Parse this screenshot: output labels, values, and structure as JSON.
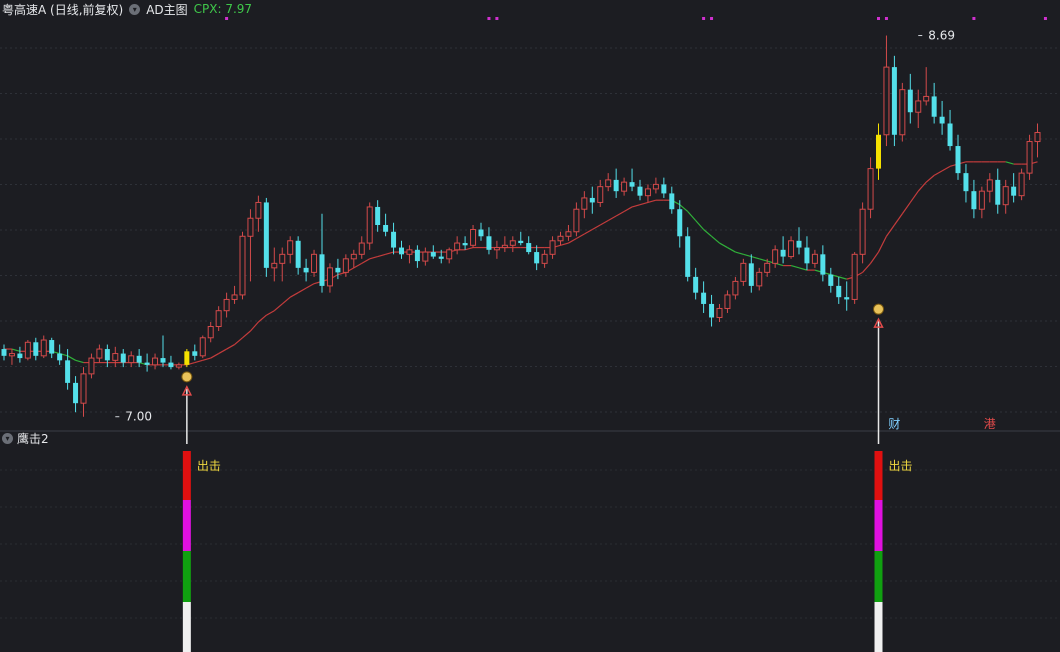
{
  "header": {
    "stock_title": "粤高速A (日线,前复权)",
    "indicator": "AD主图",
    "cpx_label": "CPX: 7.97"
  },
  "sub_panel": {
    "title": "鹰击2",
    "signal_label": "出击"
  },
  "chart_data": {
    "type": "candlestick",
    "series": [
      {
        "name": "",
        "kind": "ohlc",
        "ohlc": [
          [
            7.3,
            7.32,
            7.25,
            7.27
          ],
          [
            7.27,
            7.3,
            7.23,
            7.28
          ],
          [
            7.28,
            7.31,
            7.24,
            7.26
          ],
          [
            7.26,
            7.34,
            7.25,
            7.33
          ],
          [
            7.33,
            7.35,
            7.25,
            7.27
          ],
          [
            7.27,
            7.36,
            7.26,
            7.34
          ],
          [
            7.34,
            7.35,
            7.26,
            7.28
          ],
          [
            7.28,
            7.32,
            7.23,
            7.25
          ],
          [
            7.25,
            7.3,
            7.12,
            7.15
          ],
          [
            7.15,
            7.18,
            7.02,
            7.06
          ],
          [
            7.06,
            7.22,
            7.0,
            7.19
          ],
          [
            7.19,
            7.28,
            7.17,
            7.26
          ],
          [
            7.26,
            7.32,
            7.24,
            7.3
          ],
          [
            7.3,
            7.32,
            7.22,
            7.25
          ],
          [
            7.25,
            7.31,
            7.22,
            7.28
          ],
          [
            7.28,
            7.3,
            7.22,
            7.24
          ],
          [
            7.24,
            7.29,
            7.22,
            7.27
          ],
          [
            7.27,
            7.3,
            7.22,
            7.24
          ],
          [
            7.24,
            7.28,
            7.2,
            7.23
          ],
          [
            7.23,
            7.28,
            7.21,
            7.26
          ],
          [
            7.26,
            7.36,
            7.22,
            7.24
          ],
          [
            7.24,
            7.27,
            7.21,
            7.22
          ],
          [
            7.22,
            7.24,
            7.21,
            7.23
          ],
          [
            7.23,
            7.3,
            7.22,
            7.29
          ],
          [
            7.29,
            7.32,
            7.25,
            7.27
          ],
          [
            7.27,
            7.36,
            7.26,
            7.35
          ],
          [
            7.35,
            7.42,
            7.33,
            7.4
          ],
          [
            7.4,
            7.49,
            7.38,
            7.47
          ],
          [
            7.47,
            7.55,
            7.44,
            7.52
          ],
          [
            7.52,
            7.58,
            7.5,
            7.54
          ],
          [
            7.54,
            7.82,
            7.52,
            7.8
          ],
          [
            7.8,
            7.92,
            7.6,
            7.88
          ],
          [
            7.88,
            7.98,
            7.82,
            7.95
          ],
          [
            7.95,
            7.97,
            7.62,
            7.66
          ],
          [
            7.66,
            7.75,
            7.6,
            7.68
          ],
          [
            7.68,
            7.75,
            7.6,
            7.72
          ],
          [
            7.72,
            7.8,
            7.68,
            7.78
          ],
          [
            7.78,
            7.8,
            7.63,
            7.66
          ],
          [
            7.66,
            7.7,
            7.6,
            7.64
          ],
          [
            7.64,
            7.74,
            7.62,
            7.72
          ],
          [
            7.72,
            7.9,
            7.55,
            7.58
          ],
          [
            7.58,
            7.68,
            7.55,
            7.66
          ],
          [
            7.66,
            7.7,
            7.61,
            7.64
          ],
          [
            7.64,
            7.72,
            7.62,
            7.7
          ],
          [
            7.7,
            7.74,
            7.66,
            7.72
          ],
          [
            7.72,
            7.8,
            7.7,
            7.77
          ],
          [
            7.77,
            7.95,
            7.74,
            7.93
          ],
          [
            7.93,
            7.96,
            7.82,
            7.85
          ],
          [
            7.85,
            7.9,
            7.8,
            7.82
          ],
          [
            7.82,
            7.86,
            7.72,
            7.75
          ],
          [
            7.75,
            7.78,
            7.7,
            7.72
          ],
          [
            7.72,
            7.76,
            7.68,
            7.74
          ],
          [
            7.74,
            7.76,
            7.66,
            7.69
          ],
          [
            7.69,
            7.75,
            7.67,
            7.73
          ],
          [
            7.73,
            7.76,
            7.7,
            7.71
          ],
          [
            7.71,
            7.74,
            7.68,
            7.7
          ],
          [
            7.7,
            7.75,
            7.68,
            7.74
          ],
          [
            7.74,
            7.8,
            7.72,
            7.77
          ],
          [
            7.77,
            7.8,
            7.74,
            7.76
          ],
          [
            7.76,
            7.85,
            7.75,
            7.83
          ],
          [
            7.83,
            7.86,
            7.78,
            7.8
          ],
          [
            7.8,
            7.84,
            7.72,
            7.74
          ],
          [
            7.74,
            7.78,
            7.7,
            7.75
          ],
          [
            7.75,
            7.8,
            7.73,
            7.76
          ],
          [
            7.76,
            7.8,
            7.73,
            7.78
          ],
          [
            7.78,
            7.82,
            7.76,
            7.77
          ],
          [
            7.77,
            7.8,
            7.72,
            7.73
          ],
          [
            7.73,
            7.76,
            7.65,
            7.68
          ],
          [
            7.68,
            7.74,
            7.66,
            7.72
          ],
          [
            7.72,
            7.8,
            7.7,
            7.78
          ],
          [
            7.78,
            7.82,
            7.76,
            7.8
          ],
          [
            7.8,
            7.85,
            7.78,
            7.82
          ],
          [
            7.82,
            7.95,
            7.8,
            7.92
          ],
          [
            7.92,
            8.0,
            7.88,
            7.97
          ],
          [
            7.97,
            8.02,
            7.9,
            7.95
          ],
          [
            7.95,
            8.05,
            7.93,
            8.02
          ],
          [
            8.02,
            8.08,
            8.0,
            8.05
          ],
          [
            8.05,
            8.1,
            7.97,
            8.0
          ],
          [
            8.0,
            8.06,
            7.98,
            8.04
          ],
          [
            8.04,
            8.1,
            8.0,
            8.02
          ],
          [
            8.02,
            8.05,
            7.96,
            7.98
          ],
          [
            7.98,
            8.03,
            7.95,
            8.01
          ],
          [
            8.01,
            8.06,
            7.99,
            8.03
          ],
          [
            8.03,
            8.06,
            7.97,
            7.99
          ],
          [
            7.99,
            8.02,
            7.9,
            7.92
          ],
          [
            7.92,
            7.96,
            7.75,
            7.8
          ],
          [
            7.8,
            7.84,
            7.6,
            7.62
          ],
          [
            7.62,
            7.66,
            7.52,
            7.55
          ],
          [
            7.55,
            7.6,
            7.46,
            7.5
          ],
          [
            7.5,
            7.54,
            7.4,
            7.44
          ],
          [
            7.44,
            7.5,
            7.42,
            7.48
          ],
          [
            7.48,
            7.56,
            7.46,
            7.54
          ],
          [
            7.54,
            7.62,
            7.52,
            7.6
          ],
          [
            7.6,
            7.7,
            7.58,
            7.68
          ],
          [
            7.68,
            7.72,
            7.55,
            7.58
          ],
          [
            7.58,
            7.66,
            7.56,
            7.64
          ],
          [
            7.64,
            7.7,
            7.62,
            7.68
          ],
          [
            7.68,
            7.76,
            7.66,
            7.74
          ],
          [
            7.74,
            7.8,
            7.68,
            7.71
          ],
          [
            7.71,
            7.8,
            7.7,
            7.78
          ],
          [
            7.78,
            7.84,
            7.72,
            7.75
          ],
          [
            7.75,
            7.8,
            7.65,
            7.68
          ],
          [
            7.68,
            7.74,
            7.66,
            7.72
          ],
          [
            7.72,
            7.76,
            7.6,
            7.63
          ],
          [
            7.63,
            7.66,
            7.55,
            7.58
          ],
          [
            7.58,
            7.62,
            7.5,
            7.53
          ],
          [
            7.53,
            7.6,
            7.47,
            7.52
          ],
          [
            7.52,
            7.73,
            7.5,
            7.72
          ],
          [
            7.72,
            7.95,
            7.68,
            7.92
          ],
          [
            7.92,
            8.15,
            7.88,
            8.1
          ],
          [
            8.1,
            8.3,
            8.05,
            8.25
          ],
          [
            8.25,
            8.69,
            8.2,
            8.55
          ],
          [
            8.55,
            8.6,
            8.2,
            8.25
          ],
          [
            8.25,
            8.48,
            8.22,
            8.45
          ],
          [
            8.45,
            8.52,
            8.3,
            8.35
          ],
          [
            8.35,
            8.45,
            8.28,
            8.4
          ],
          [
            8.4,
            8.55,
            8.38,
            8.42
          ],
          [
            8.42,
            8.48,
            8.3,
            8.33
          ],
          [
            8.33,
            8.4,
            8.25,
            8.3
          ],
          [
            8.3,
            8.36,
            8.18,
            8.2
          ],
          [
            8.2,
            8.25,
            8.05,
            8.08
          ],
          [
            8.08,
            8.12,
            7.95,
            8.0
          ],
          [
            8.0,
            8.05,
            7.88,
            7.92
          ],
          [
            7.92,
            8.02,
            7.88,
            8.0
          ],
          [
            8.0,
            8.08,
            7.95,
            8.05
          ],
          [
            8.05,
            8.1,
            7.9,
            7.94
          ],
          [
            7.94,
            8.05,
            7.9,
            8.02
          ],
          [
            8.02,
            8.08,
            7.95,
            7.98
          ],
          [
            7.98,
            8.1,
            7.96,
            8.08
          ],
          [
            8.08,
            8.25,
            8.05,
            8.22
          ],
          [
            8.22,
            8.3,
            8.15,
            8.26
          ]
        ],
        "up_color": "#d34a4a",
        "down_color": "#54e0ea"
      },
      {
        "name": "",
        "kind": "line",
        "values": [
          7.3,
          7.3,
          7.29,
          7.29,
          7.29,
          7.29,
          7.29,
          7.28,
          7.27,
          7.25,
          7.24,
          7.24,
          7.24,
          7.24,
          7.24,
          7.24,
          7.24,
          7.24,
          7.23,
          7.23,
          7.23,
          7.23,
          7.23,
          7.23,
          7.24,
          7.25,
          7.26,
          7.28,
          7.3,
          7.32,
          7.35,
          7.38,
          7.42,
          7.45,
          7.47,
          7.5,
          7.53,
          7.55,
          7.57,
          7.59,
          7.6,
          7.61,
          7.63,
          7.64,
          7.66,
          7.68,
          7.7,
          7.71,
          7.72,
          7.73,
          7.73,
          7.73,
          7.73,
          7.73,
          7.73,
          7.73,
          7.73,
          7.74,
          7.74,
          7.75,
          7.75,
          7.75,
          7.75,
          7.75,
          7.75,
          7.75,
          7.75,
          7.75,
          7.75,
          7.75,
          7.76,
          7.77,
          7.79,
          7.81,
          7.83,
          7.85,
          7.87,
          7.89,
          7.91,
          7.93,
          7.94,
          7.95,
          7.96,
          7.96,
          7.96,
          7.94,
          7.91,
          7.87,
          7.83,
          7.8,
          7.77,
          7.75,
          7.73,
          7.72,
          7.71,
          7.7,
          7.69,
          7.68,
          7.67,
          7.67,
          7.66,
          7.65,
          7.65,
          7.64,
          7.63,
          7.62,
          7.61,
          7.62,
          7.64,
          7.68,
          7.73,
          7.8,
          7.85,
          7.9,
          7.95,
          8.0,
          8.04,
          8.07,
          8.09,
          8.11,
          8.12,
          8.13,
          8.13,
          8.13,
          8.13,
          8.13,
          8.13,
          8.12,
          8.12,
          8.12,
          8.13
        ],
        "up_color": "#c43c3c",
        "down_color": "#30b03a"
      }
    ],
    "ylim": [
      6.95,
      8.75
    ],
    "annotations": [
      {
        "text": "7.00",
        "x": 14,
        "y": 7.0
      },
      {
        "text": "8.69",
        "x": 115,
        "y": 8.69
      },
      {
        "text": "财",
        "x": 112
      },
      {
        "text": "港",
        "x": 124
      }
    ],
    "signals": [
      {
        "x": 23,
        "y": 7.23,
        "label": "出击"
      },
      {
        "x": 110,
        "y": 7.53,
        "label": "出击"
      }
    ],
    "top_markers": [
      28,
      61,
      62,
      88,
      89,
      110,
      111,
      122,
      131
    ],
    "highlight_bars": [
      {
        "x": 23,
        "color": "#f5e100"
      },
      {
        "x": 110,
        "color": "#f5e100"
      }
    ],
    "indicator_bar_colors": [
      "#e01010",
      "#e010e0",
      "#10a010",
      "#f0f0f0"
    ]
  }
}
